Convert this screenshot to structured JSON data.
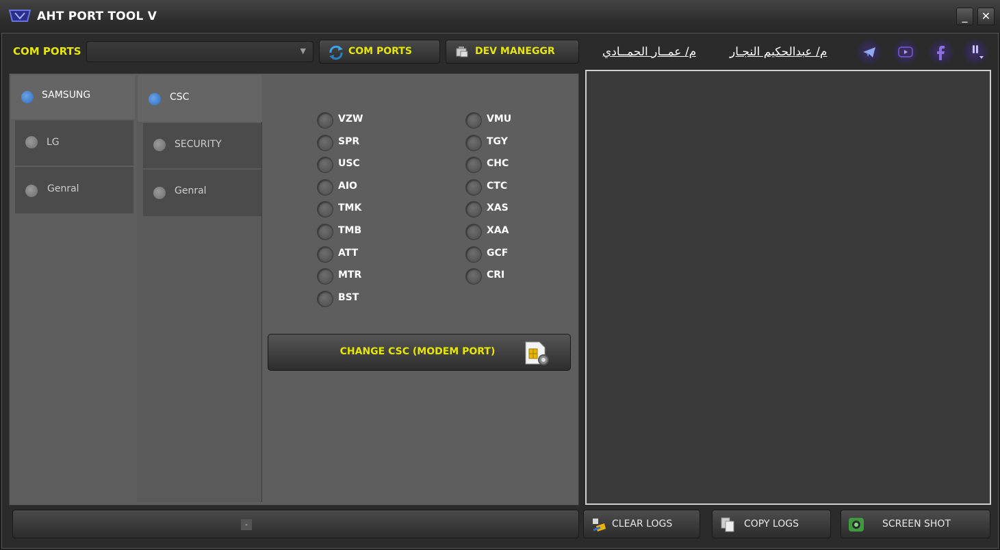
{
  "window": {
    "title": "AHT PORT TOOL V",
    "minimize_label": "_",
    "close_label": "✕"
  },
  "toolbar": {
    "com_ports_label": "COM PORTS",
    "com_ports_value": "",
    "dropdown_arrow": "▼",
    "com_ports_button": "COM PORTS",
    "dev_manager_button": "DEV MANEGGR",
    "author_1": "م/ عمــار الحمــادي",
    "author_2": "م/ عبدالحكيم النجـار",
    "social_icons": [
      "telegram-icon",
      "youtube-icon",
      "facebook-icon",
      "viber-icon"
    ]
  },
  "brands": {
    "items": [
      {
        "label": "SAMSUNG",
        "active": true
      },
      {
        "label": "LG",
        "active": false
      },
      {
        "label": "Genral",
        "active": false
      }
    ]
  },
  "functions": {
    "items": [
      {
        "label": "CSC",
        "active": true
      },
      {
        "label": "SECURITY",
        "active": false
      },
      {
        "label": "Genral",
        "active": false
      }
    ]
  },
  "csc": {
    "left_column": [
      "VZW",
      "SPR",
      "USC",
      "AIO",
      "TMK",
      "TMB",
      "ATT",
      "MTR",
      "BST"
    ],
    "right_column": [
      "VMU",
      "TGY",
      "CHC",
      "CTC",
      "XAS",
      "XAA",
      "GCF",
      "CRI"
    ],
    "change_button": "CHANGE  CSC  (MODEM PORT)"
  },
  "log": {
    "content": ""
  },
  "bottom": {
    "status_text": "-",
    "clear_logs": "CLEAR LOGS",
    "copy_logs": "COPY LOGS",
    "screenshot": "SCREEN SHOT"
  },
  "colors": {
    "accent": "#e6e600",
    "active_dot": "#2e6bbd",
    "panel": "#5e5e5e",
    "log_bg": "#3a3a3a"
  }
}
